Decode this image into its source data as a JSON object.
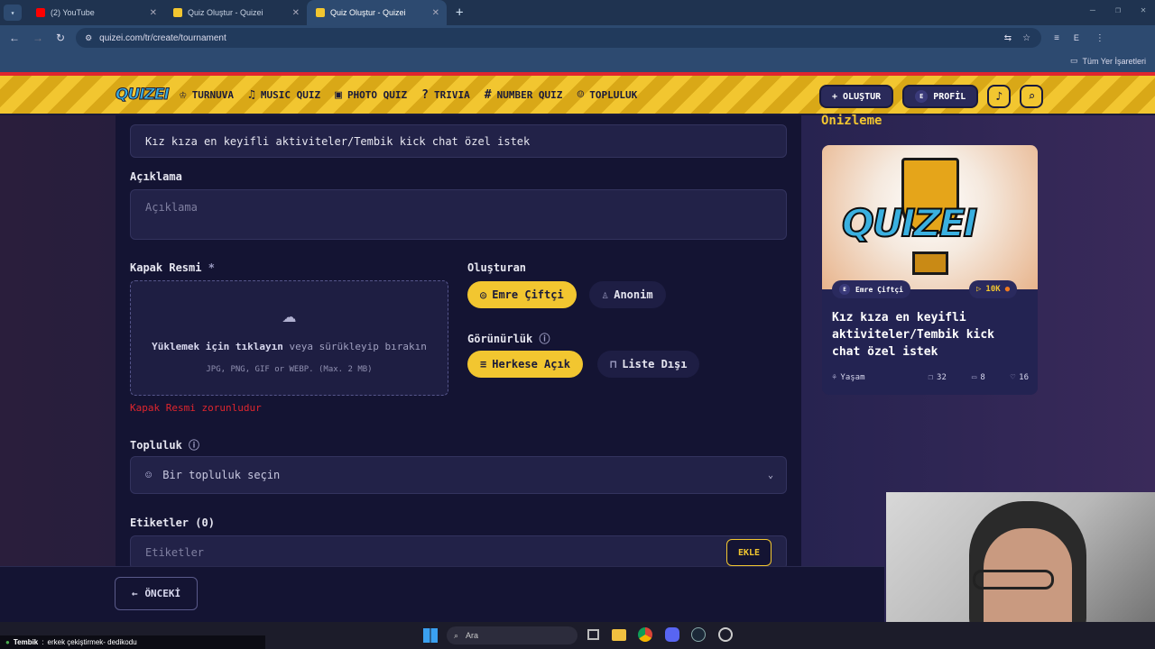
{
  "browser": {
    "tabs": [
      {
        "title": "(2) YouTube",
        "color": "#ff0000"
      },
      {
        "title": "Quiz Oluştur - Quizei",
        "color": "#f2c630"
      },
      {
        "title": "Quiz Oluştur - Quizei",
        "color": "#f2c630",
        "active": true
      }
    ],
    "url": "quizei.com/tr/create/tournament",
    "profile_initial": "E",
    "bookmarks_label": "Tüm Yer İşaretleri"
  },
  "nav": {
    "logo": "QUIZEI",
    "items": [
      {
        "label": "TURNUVA",
        "icon": "trophy-icon"
      },
      {
        "label": "MUSIC QUIZ",
        "icon": "music-note-icon"
      },
      {
        "label": "PHOTO QUIZ",
        "icon": "camera-icon"
      },
      {
        "label": "TRIVIA",
        "icon": "question-bubble-icon"
      },
      {
        "label": "NUMBER QUIZ",
        "icon": "hash-icon"
      },
      {
        "label": "TOPLULUK",
        "icon": "users-icon"
      }
    ],
    "create_label": "OLUŞTUR",
    "profile_initial": "E",
    "profile_label": "PROFİL"
  },
  "form": {
    "title_value": "Kız kıza en keyifli aktiviteler/Tembik kick chat özel istek",
    "description_label": "Açıklama",
    "description_placeholder": "Açıklama",
    "cover_label": "Kapak Resmi",
    "cover_required_mark": "*",
    "upload_main": "Yüklemek için tıklayın",
    "upload_rest": "veya sürükleyip bırakın",
    "upload_formats": "JPG, PNG, GIF or WEBP. (Max. 2 MB)",
    "cover_error": "Kapak Resmi zorunludur",
    "creator_label": "Oluşturan",
    "creator_options": [
      "Emre Çiftçi",
      "Anonim"
    ],
    "visibility_label": "Görünürlük",
    "visibility_options": [
      "Herkese Açık",
      "Liste Dışı"
    ],
    "community_label": "Topluluk",
    "community_placeholder": "Bir topluluk seçin",
    "tags_label": "Etiketler (0)",
    "tags_placeholder": "Etiketler",
    "tags_add": "EKLE",
    "back_button": "ÖNCEKİ"
  },
  "preview": {
    "heading": "Önizleme",
    "cover_text": "QUIZEI",
    "author_initial": "E",
    "author": "Emre Çiftçi",
    "plays": "10K",
    "title": "Kız kıza en keyifli aktiviteler/Tembik kick chat özel istek",
    "category": "Yaşam",
    "questions": "32",
    "comments": "8",
    "likes": "16"
  },
  "taskbar": {
    "search_placeholder": "Ara",
    "stream_ticker_name": "Tembik",
    "stream_ticker_text": "erkek çekiştirmek- dedikodu"
  },
  "colors": {
    "accent": "#f2c630",
    "bg": "#141433",
    "error": "#e0262e"
  }
}
